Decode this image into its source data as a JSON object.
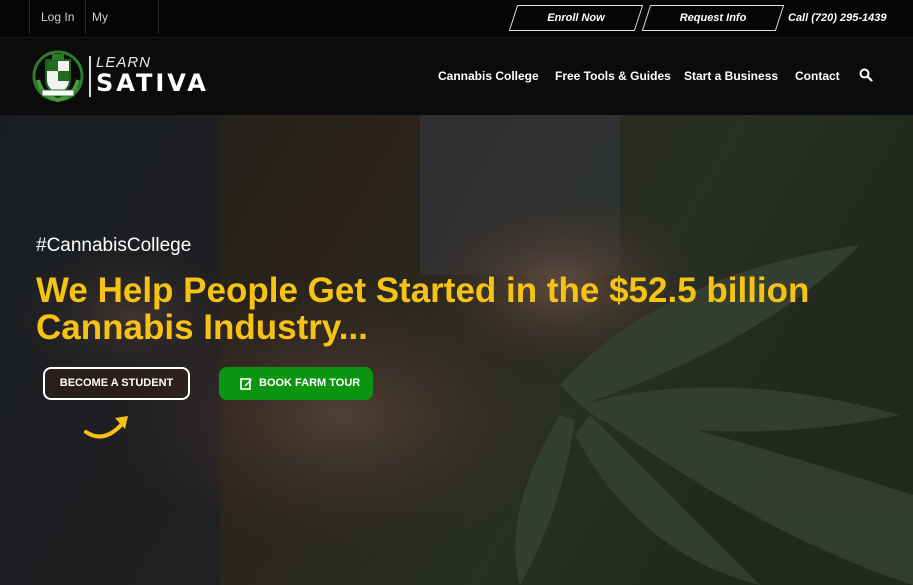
{
  "topbar": {
    "login": "Log In",
    "account": "My Account",
    "enroll": "Enroll Now",
    "request": "Request Info",
    "phone": "Call (720) 295-1439"
  },
  "logo": {
    "line1": "LEARN",
    "line2": "SATIVA"
  },
  "nav": {
    "items": [
      "Cannabis College",
      "Free Tools & Guides",
      "Start a Business",
      "Contact"
    ],
    "search_icon": "search-icon"
  },
  "hero": {
    "hashtag": "#CannabisCollege",
    "headline": "We Help People Get Started in the $52.5 billion Cannabis Industry...",
    "primary_button": "BECOME A STUDENT",
    "secondary_button": "BOOK FARM TOUR",
    "secondary_icon": "edit-icon",
    "accent": "#f6c314",
    "green": "#0d9411"
  }
}
